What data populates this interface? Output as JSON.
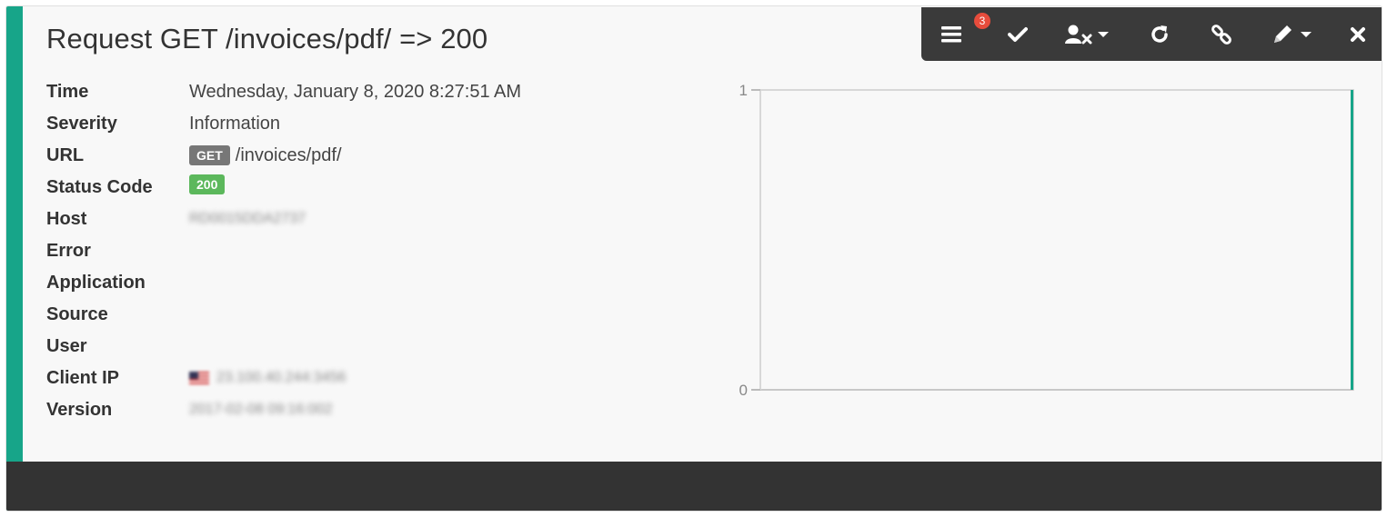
{
  "header": {
    "title": "Request GET /invoices/pdf/ => 200"
  },
  "toolbar": {
    "menu_badge": "3",
    "buttons": [
      "menu-icon",
      "check-icon",
      "user-remove-icon",
      "refresh-icon",
      "link-icon",
      "pencil-icon",
      "close-icon"
    ]
  },
  "details": {
    "time": {
      "label": "Time",
      "value": "Wednesday, January 8, 2020 8:27:51 AM"
    },
    "severity": {
      "label": "Severity",
      "value": "Information"
    },
    "url": {
      "label": "URL",
      "method": "GET",
      "path": "/invoices/pdf/"
    },
    "status_code": {
      "label": "Status Code",
      "value": "200"
    },
    "host": {
      "label": "Host",
      "value": "RD0015DDA2737"
    },
    "error": {
      "label": "Error",
      "value": ""
    },
    "application": {
      "label": "Application",
      "value": ""
    },
    "source": {
      "label": "Source",
      "value": ""
    },
    "user": {
      "label": "User",
      "value": ""
    },
    "client_ip": {
      "label": "Client IP",
      "value": "23.100.40.244:3456"
    },
    "version": {
      "label": "Version",
      "value": "2017-02-08 09:16:002"
    }
  },
  "colors": {
    "accent": "#17a589",
    "toolbar_bg": "#3a3a3a",
    "badge_red": "#e74c3c",
    "status_green": "#5cb85c",
    "method_gray": "#777777"
  },
  "chart_data": {
    "type": "bar",
    "title": "",
    "xlabel": "",
    "ylabel": "",
    "ylim": [
      0,
      1
    ],
    "yticks": [
      "1",
      "0"
    ],
    "series": [
      {
        "values": [
          1
        ]
      }
    ]
  }
}
